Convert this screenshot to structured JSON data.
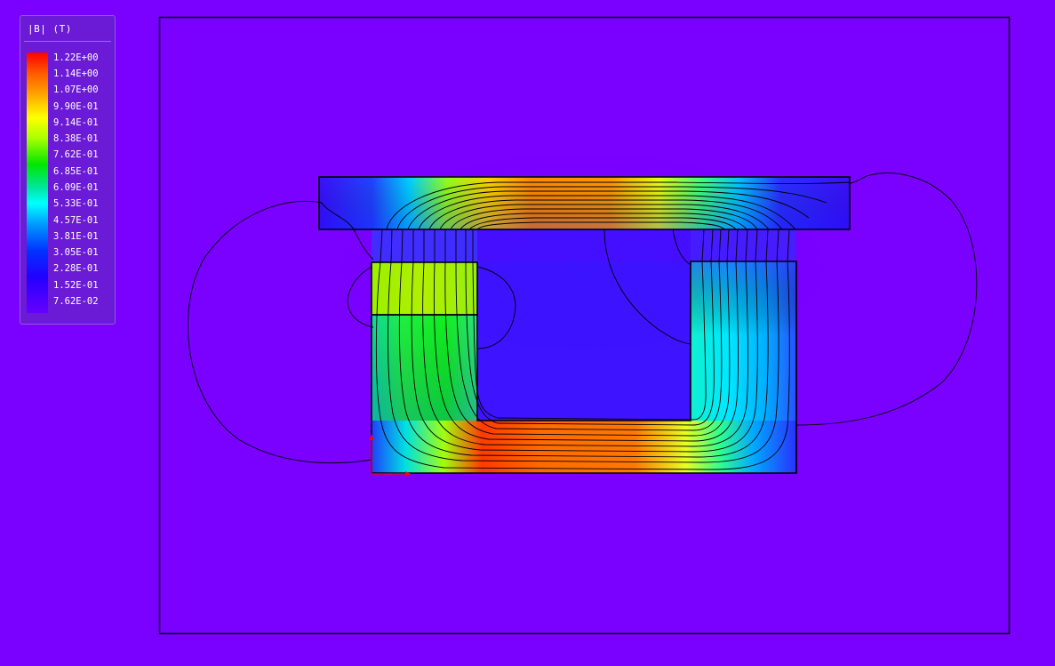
{
  "legend": {
    "title": "|B| (T)",
    "labels": [
      "1.22E+00",
      "1.14E+00",
      "1.07E+00",
      "9.90E-01",
      "9.14E-01",
      "8.38E-01",
      "7.62E-01",
      "6.85E-01",
      "6.09E-01",
      "5.33E-01",
      "4.57E-01",
      "3.81E-01",
      "3.05E-01",
      "2.28E-01",
      "1.52E-01",
      "7.62E-02"
    ]
  },
  "colors": {
    "background": "#7a00ff",
    "legend_bg": "#6b1ad6",
    "axis_marker": "#ff0000"
  }
}
